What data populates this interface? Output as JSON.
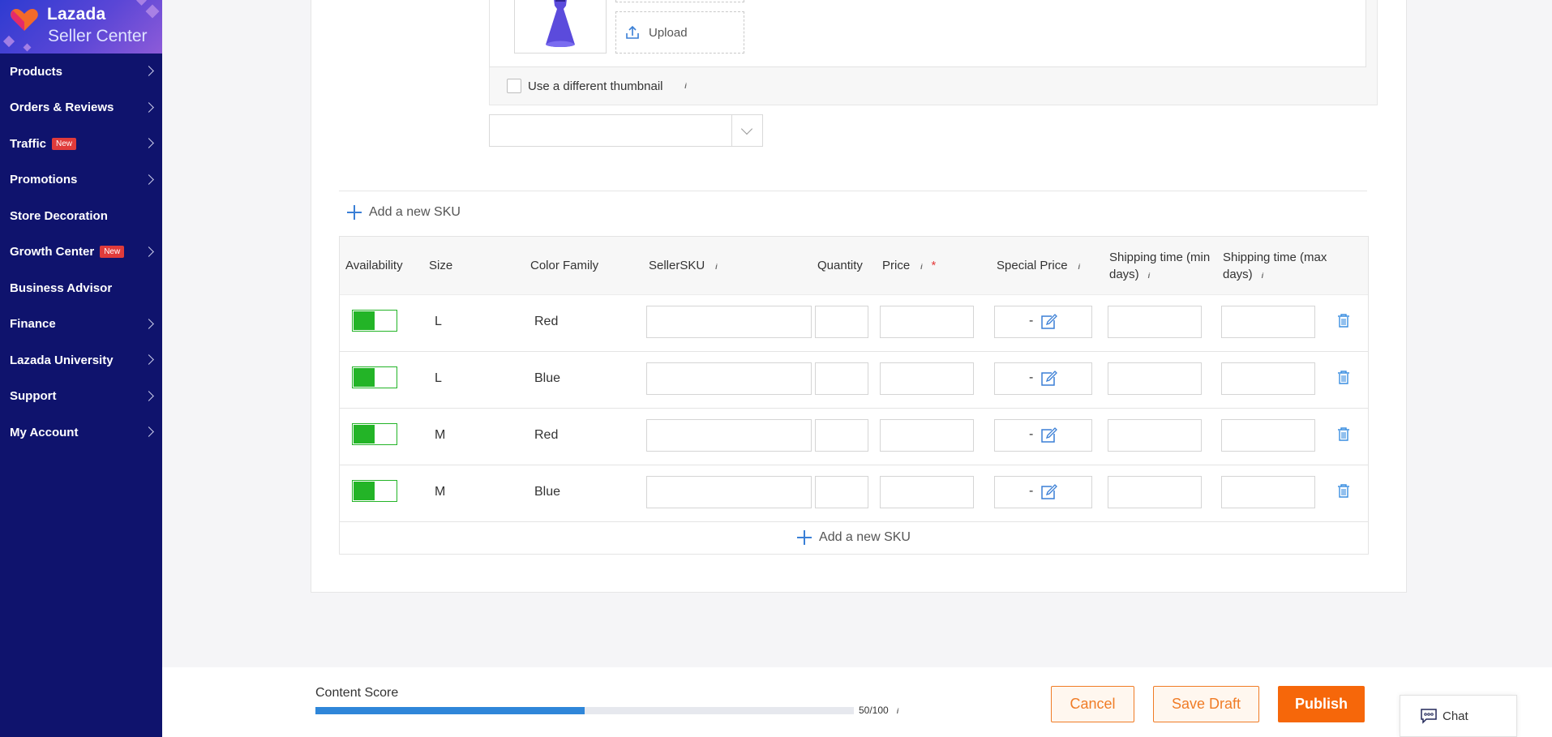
{
  "sidebar": {
    "logo": {
      "line1": "Lazada",
      "line2": "Seller Center"
    },
    "items": [
      {
        "label": "Products",
        "badge": "",
        "has_chevron": true
      },
      {
        "label": "Orders & Reviews",
        "badge": "",
        "has_chevron": true
      },
      {
        "label": "Traffic",
        "badge": "New",
        "has_chevron": true
      },
      {
        "label": "Promotions",
        "badge": "",
        "has_chevron": true
      },
      {
        "label": "Store Decoration",
        "badge": "",
        "has_chevron": false
      },
      {
        "label": "Growth Center",
        "badge": "New",
        "has_chevron": true
      },
      {
        "label": "Business Advisor",
        "badge": "",
        "has_chevron": false
      },
      {
        "label": "Finance",
        "badge": "",
        "has_chevron": true
      },
      {
        "label": "Lazada University",
        "badge": "",
        "has_chevron": true
      },
      {
        "label": "Support",
        "badge": "",
        "has_chevron": true
      },
      {
        "label": "My Account",
        "badge": "",
        "has_chevron": true
      }
    ]
  },
  "variant": {
    "upload_label": "Upload",
    "thumbnail_checkbox_label": "Use a different thumbnail",
    "select_value": ""
  },
  "sku": {
    "add_new_label": "Add a new SKU",
    "headers": {
      "availability": "Availability",
      "size": "Size",
      "color_family": "Color Family",
      "seller_sku": "SellerSKU",
      "quantity": "Quantity",
      "price": "Price",
      "price_required": "*",
      "special_price": "Special Price",
      "shipping_min": "Shipping time (min days)",
      "shipping_max": "Shipping time (max days)"
    },
    "rows": [
      {
        "enabled": true,
        "size": "L",
        "color": "Red",
        "special_price": "-"
      },
      {
        "enabled": true,
        "size": "L",
        "color": "Blue",
        "special_price": "-"
      },
      {
        "enabled": true,
        "size": "M",
        "color": "Red",
        "special_price": "-"
      },
      {
        "enabled": true,
        "size": "M",
        "color": "Blue",
        "special_price": "-"
      }
    ]
  },
  "footer": {
    "content_score_label": "Content Score",
    "content_score_value": "50/100",
    "content_score_fraction": 0.5,
    "cancel_label": "Cancel",
    "save_draft_label": "Save Draft",
    "publish_label": "Publish",
    "chat_label": "Chat"
  },
  "colors": {
    "sidebar_bg": "#0f136d",
    "accent_orange": "#f6670a",
    "toggle_green": "#23b427",
    "progress_blue": "#2f86d9",
    "badge_red": "#e03b3b"
  },
  "icons": {
    "upload": "upload-icon",
    "info": "info-icon",
    "plus": "plus-icon",
    "edit": "edit-icon",
    "trash": "trash-icon",
    "chat": "chat-icon",
    "chevron": "chevron-right-icon"
  }
}
